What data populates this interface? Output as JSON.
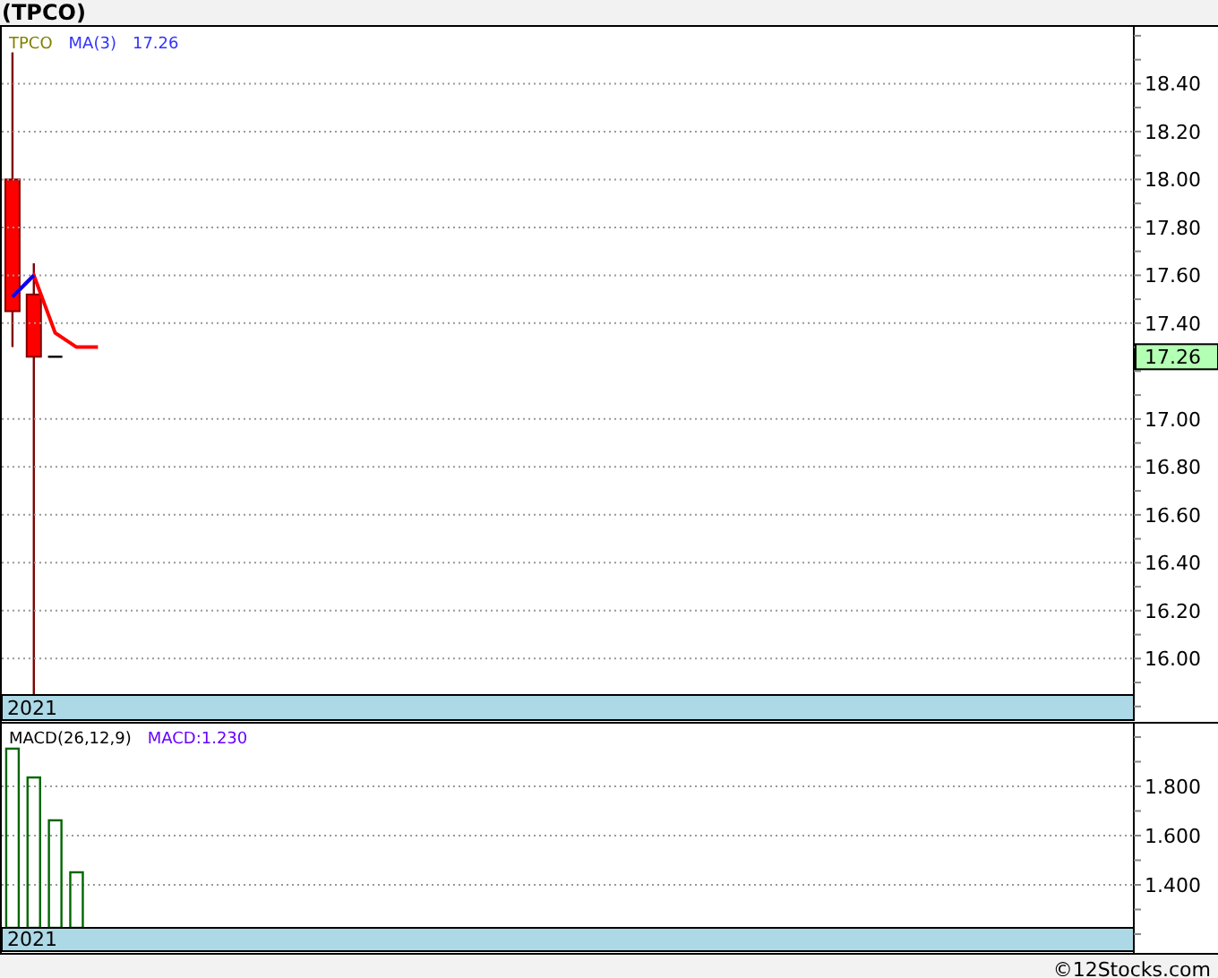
{
  "title": "(TPCO)",
  "price_panel": {
    "legend": [
      {
        "text": "TPCO",
        "color": "#808000"
      },
      {
        "text": "MA(3)",
        "color": "#3333ff"
      },
      {
        "text": "17.26",
        "color": "#3333ff"
      }
    ],
    "ma_rising": {
      "color": "#0000ff"
    },
    "last_price": "17.26",
    "band_label": "2021",
    "chart_data": {
      "type": "line",
      "grid": true,
      "categories": [
        null,
        null,
        null,
        null,
        null,
        null,
        null,
        null,
        null,
        null,
        null,
        null,
        null,
        null,
        null,
        null,
        null,
        null,
        null,
        null,
        null,
        null,
        null,
        null,
        null,
        null,
        null,
        null,
        null,
        null,
        null,
        null,
        null,
        null,
        null,
        null,
        null,
        null,
        null,
        null,
        null,
        null,
        null,
        null,
        null,
        null,
        null,
        null,
        null,
        null,
        null,
        null,
        null
      ],
      "ylim": [
        15.848,
        18.637
      ],
      "yticks": [
        {
          "value": 18.4,
          "label": "18.40"
        },
        {
          "value": 18.2,
          "label": "18.20"
        },
        {
          "value": 18.0,
          "label": "18.00"
        },
        {
          "value": 17.8,
          "label": "17.80"
        },
        {
          "value": 17.6,
          "label": "17.60"
        },
        {
          "value": 17.4,
          "label": "17.40"
        },
        {
          "value": 17.0,
          "label": "17.00"
        },
        {
          "value": 16.8,
          "label": "16.80"
        },
        {
          "value": 16.6,
          "label": "16.60"
        },
        {
          "value": 16.4,
          "label": "16.40"
        },
        {
          "value": 16.2,
          "label": "16.20"
        },
        {
          "value": 16.0,
          "label": "16.00"
        }
      ],
      "series": [
        {
          "color": "#ff0000",
          "values": [
            17.51,
            17.6,
            17.36,
            17.3,
            17.3,
            null,
            null,
            null,
            null,
            null,
            null,
            null,
            null,
            null,
            null,
            null,
            null,
            null,
            null,
            null,
            null,
            null,
            null,
            null,
            null,
            null,
            null,
            null,
            null,
            null,
            null,
            null,
            null,
            null,
            null,
            null,
            null,
            null,
            null,
            null,
            null,
            null,
            null,
            null,
            null,
            null,
            null,
            null,
            null,
            null,
            null,
            null,
            null
          ]
        }
      ]
    }
  },
  "macd_panel": {
    "legend": [
      {
        "text": "MACD(26,12,9)",
        "color": "#000000"
      },
      {
        "text": "MACD:1.230",
        "color": "#6600ff"
      }
    ],
    "band_label": "2021",
    "chart_data": {
      "type": "bar",
      "grid": true,
      "categories": [
        null,
        null,
        null,
        null,
        null,
        null,
        null,
        null,
        null,
        null,
        null,
        null,
        null,
        null,
        null,
        null,
        null,
        null,
        null,
        null,
        null,
        null,
        null,
        null,
        null,
        null,
        null,
        null,
        null,
        null,
        null,
        null,
        null,
        null,
        null,
        null,
        null,
        null,
        null,
        null,
        null,
        null,
        null,
        null,
        null,
        null,
        null,
        null,
        null,
        null,
        null,
        null,
        null
      ],
      "ylim": [
        1.2255,
        2.0545
      ],
      "yticks": [
        {
          "value": 1.8,
          "label": "1.800"
        },
        {
          "value": 1.6,
          "label": "1.600"
        },
        {
          "value": 1.4,
          "label": "1.400"
        }
      ],
      "series": [
        {
          "color": "#006600",
          "values": [
            1.953,
            1.836,
            1.662,
            1.451,
            null,
            null,
            null,
            null,
            null,
            null,
            null,
            null,
            null,
            null,
            null,
            null,
            null,
            null,
            null,
            null,
            null,
            null,
            null,
            null,
            null,
            null,
            null,
            null,
            null,
            null,
            null,
            null,
            null,
            null,
            null,
            null,
            null,
            null,
            null,
            null,
            null,
            null,
            null,
            null,
            null,
            null,
            null,
            null,
            null,
            null,
            null,
            null,
            null
          ]
        }
      ]
    }
  },
  "footer": "©12Stocks.com"
}
